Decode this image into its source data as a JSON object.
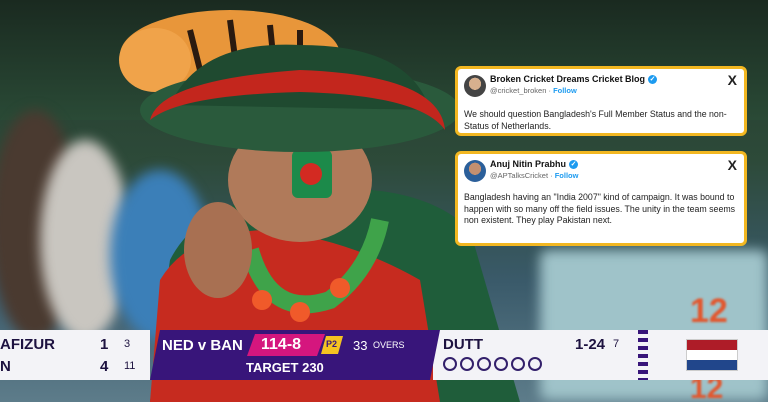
{
  "tweets": [
    {
      "name": "Broken Cricket Dreams Cricket Blog",
      "handle": "@cricket_broken",
      "follow": "Follow",
      "close": "X",
      "text": "We should question Bangladesh's Full Member Status and the non-Status of Netherlands."
    },
    {
      "name": "Anuj Nitin Prabhu",
      "handle": "@APTalksCricket",
      "follow": "Follow",
      "close": "X",
      "text": "Bangladesh having an \"India 2007\" kind of campaign. It was bound to happen with so many off the field issues. The unity in the team seems non existent. They play Pakistan next."
    }
  ],
  "scoreboard": {
    "batters": [
      {
        "name": "AFIZUR",
        "runs": "1",
        "balls": "3"
      },
      {
        "name": "N",
        "runs": "4",
        "balls": "11"
      }
    ],
    "match": "NED v BAN",
    "score": "114-8",
    "powerplay": "P2",
    "overs_value": "33",
    "overs_label": "OVERS",
    "target": "TARGET 230",
    "bowler": {
      "name": "DUTT",
      "figures": "1-24",
      "overs": "7"
    },
    "ball_count": 6
  },
  "background": {
    "stand_numbers": [
      "12",
      "12"
    ]
  },
  "colors": {
    "tweet_border": "#f2b721",
    "scoreboard_purple": "#38157a",
    "score_pink": "#d5167e",
    "powerplay_yellow": "#f5c321",
    "verified": "#1d9bf0"
  }
}
